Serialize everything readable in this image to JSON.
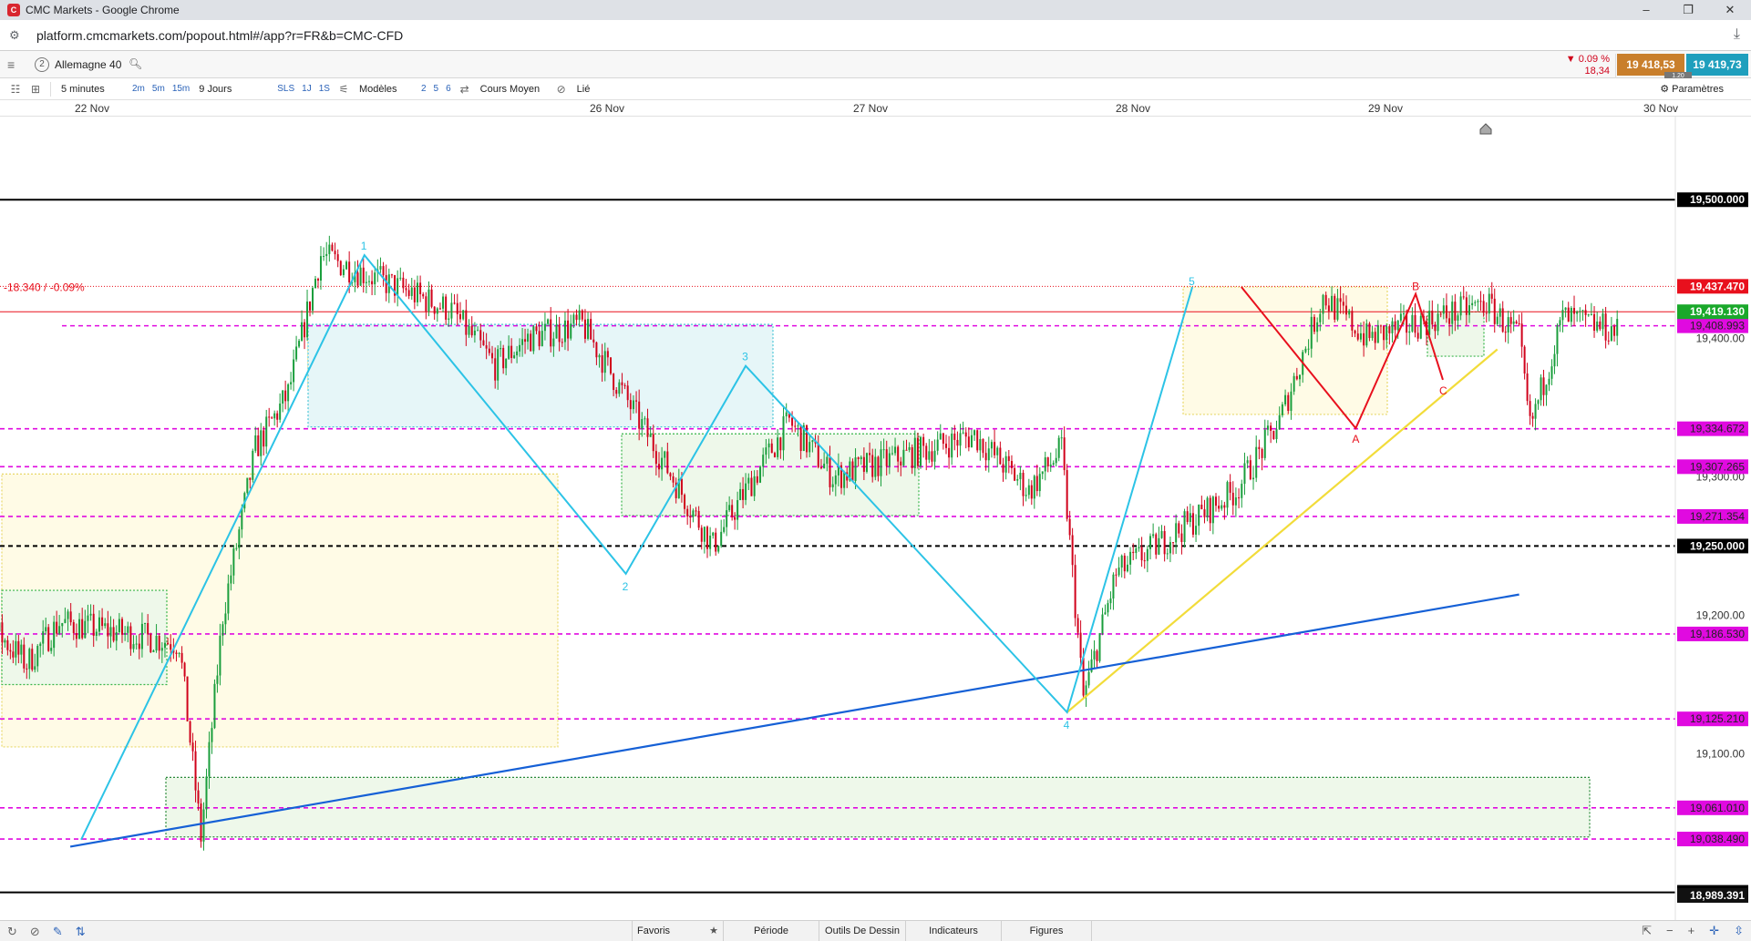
{
  "browser": {
    "window_title": "CMC Markets - Google Chrome",
    "url": "platform.cmcmarkets.com/popout.html#/app?r=FR&b=CMC-CFD"
  },
  "instrument": {
    "index": "2",
    "name": "Allemagne 40",
    "change_pct": "▼ 0.09 %",
    "change_abs": "18,34",
    "sell": "19 418,53",
    "buy": "19 419,73",
    "spread": "1.20"
  },
  "toolbar": {
    "interval": "5 minutes",
    "quick_intervals": [
      "2m",
      "5m",
      "15m"
    ],
    "period": "9 Jours",
    "quick_periods": [
      "SLS",
      "1J",
      "1S"
    ],
    "models_label": "Modèles",
    "model_options": [
      "2",
      "5",
      "6"
    ],
    "price_type": "Cours Moyen",
    "linked": "Lié",
    "settings": "Paramètres"
  },
  "bottom_bar": {
    "tabs": [
      "Favoris",
      "Période",
      "Outils De Dessin",
      "Indicateurs",
      "Figures"
    ]
  },
  "colors": {
    "up": "#1a9e3c",
    "down": "#d0021b",
    "wave": "#2cc3e6",
    "abc": "#e8101d",
    "support_yellow": "#f2dc3a",
    "support_blue": "#1560d6",
    "level_magenta": "#e00ae0",
    "last_price_green": "#1aa82b",
    "alert_red": "#e8101d"
  },
  "chart_data": {
    "type": "candlestick",
    "x_range": [
      "21 Nov",
      "30 Nov"
    ],
    "date_ticks": [
      "22 Nov",
      "26 Nov",
      "27 Nov",
      "28 Nov",
      "29 Nov",
      "30 Nov"
    ],
    "ylim": [
      18980,
      19560
    ],
    "y_ticks": [
      "19,400.00",
      "19,300.00",
      "19,200.00",
      "19,100.00"
    ],
    "round_levels": [
      {
        "label": "19,500.000",
        "value": 19500,
        "style": "solid"
      },
      {
        "label": "19,250.000",
        "value": 19250,
        "style": "dashed"
      },
      {
        "label": "19,000.000",
        "value": 19000,
        "style": "solid"
      }
    ],
    "magenta_levels": [
      {
        "label": "19,408.993",
        "value": 19408.993
      },
      {
        "label": "19,334.672",
        "value": 19334.672
      },
      {
        "label": "19,307.265",
        "value": 19307.265
      },
      {
        "label": "19,271.354",
        "value": 19271.354
      },
      {
        "label": "19,186.530",
        "value": 19186.53
      },
      {
        "label": "19,125.210",
        "value": 19125.21
      },
      {
        "label": "19,061.010",
        "value": 19061.01
      },
      {
        "label": "19,038.490",
        "value": 19038.49
      }
    ],
    "alert_level": {
      "label": "19,437.470",
      "value": 19437.47
    },
    "last_price": {
      "label": "19,419.130",
      "value": 19419.13
    },
    "axis_bottom_label": "18,989.391",
    "change_annotation": "-18.340 / -0.09%",
    "price_path": [
      {
        "t": "21 Nov 11:00",
        "y": 19160
      },
      {
        "t": "21 Nov 15:00",
        "y": 19190
      },
      {
        "t": "21 Nov 18:00",
        "y": 19165
      },
      {
        "t": "21 Nov 21:00",
        "y": 19195
      },
      {
        "t": "22 Nov 08:00",
        "y": 19180
      },
      {
        "t": "22 Nov 10:00",
        "y": 19040
      },
      {
        "t": "22 Nov 12:00",
        "y": 19200
      },
      {
        "t": "22 Nov 15:00",
        "y": 19320
      },
      {
        "t": "22 Nov 18:00",
        "y": 19360
      },
      {
        "t": "22 Nov 21:00",
        "y": 19460
      },
      {
        "t": "25 Nov 09:00",
        "y": 19420
      },
      {
        "t": "25 Nov 13:00",
        "y": 19380
      },
      {
        "t": "25 Nov 16:00",
        "y": 19400
      },
      {
        "t": "25 Nov 21:00",
        "y": 19410
      },
      {
        "t": "26 Nov 09:00",
        "y": 19250
      },
      {
        "t": "26 Nov 12:00",
        "y": 19290
      },
      {
        "t": "26 Nov 16:00",
        "y": 19340
      },
      {
        "t": "26 Nov 20:00",
        "y": 19300
      },
      {
        "t": "27 Nov 09:00",
        "y": 19330
      },
      {
        "t": "27 Nov 14:00",
        "y": 19290
      },
      {
        "t": "27 Nov 17:00",
        "y": 19320
      },
      {
        "t": "27 Nov 19:00",
        "y": 19140
      },
      {
        "t": "27 Nov 22:00",
        "y": 19230
      },
      {
        "t": "28 Nov 09:00",
        "y": 19290
      },
      {
        "t": "28 Nov 13:00",
        "y": 19340
      },
      {
        "t": "28 Nov 17:00",
        "y": 19430
      },
      {
        "t": "28 Nov 21:00",
        "y": 19400
      },
      {
        "t": "29 Nov 08:00",
        "y": 19425
      },
      {
        "t": "29 Nov 11:00",
        "y": 19400
      },
      {
        "t": "29 Nov 12:00",
        "y": 19335
      },
      {
        "t": "29 Nov 15:00",
        "y": 19415
      },
      {
        "t": "29 Nov 20:00",
        "y": 19405
      }
    ],
    "elliott_wave": [
      {
        "label": "",
        "t": "21 Nov 23:00",
        "y": 19038
      },
      {
        "label": "1",
        "t": "25 Nov 01:00",
        "y": 19460
      },
      {
        "label": "2",
        "t": "26 Nov 01:00",
        "y": 19230
      },
      {
        "label": "3",
        "t": "26 Nov 12:00",
        "y": 19380
      },
      {
        "label": "4",
        "t": "27 Nov 17:30",
        "y": 19130
      },
      {
        "label": "5",
        "t": "28 Nov 05:00",
        "y": 19437
      }
    ],
    "abc_pattern": [
      {
        "label": "",
        "t": "28 Nov 09:30",
        "y": 19437
      },
      {
        "label": "A",
        "t": "28 Nov 20:00",
        "y": 19335
      },
      {
        "label": "B",
        "t": "29 Nov 01:30",
        "y": 19432
      },
      {
        "label": "C",
        "t": "29 Nov 04:00",
        "y": 19370
      }
    ],
    "trendlines": [
      {
        "name": "yellow",
        "from": {
          "t": "27 Nov 17:30",
          "y": 19130
        },
        "to": {
          "t": "29 Nov 09:00",
          "y": 19392
        }
      },
      {
        "name": "blue",
        "from": {
          "t": "21 Nov 22:00",
          "y": 19033
        },
        "to": {
          "t": "29 Nov 11:00",
          "y": 19215
        }
      }
    ]
  }
}
